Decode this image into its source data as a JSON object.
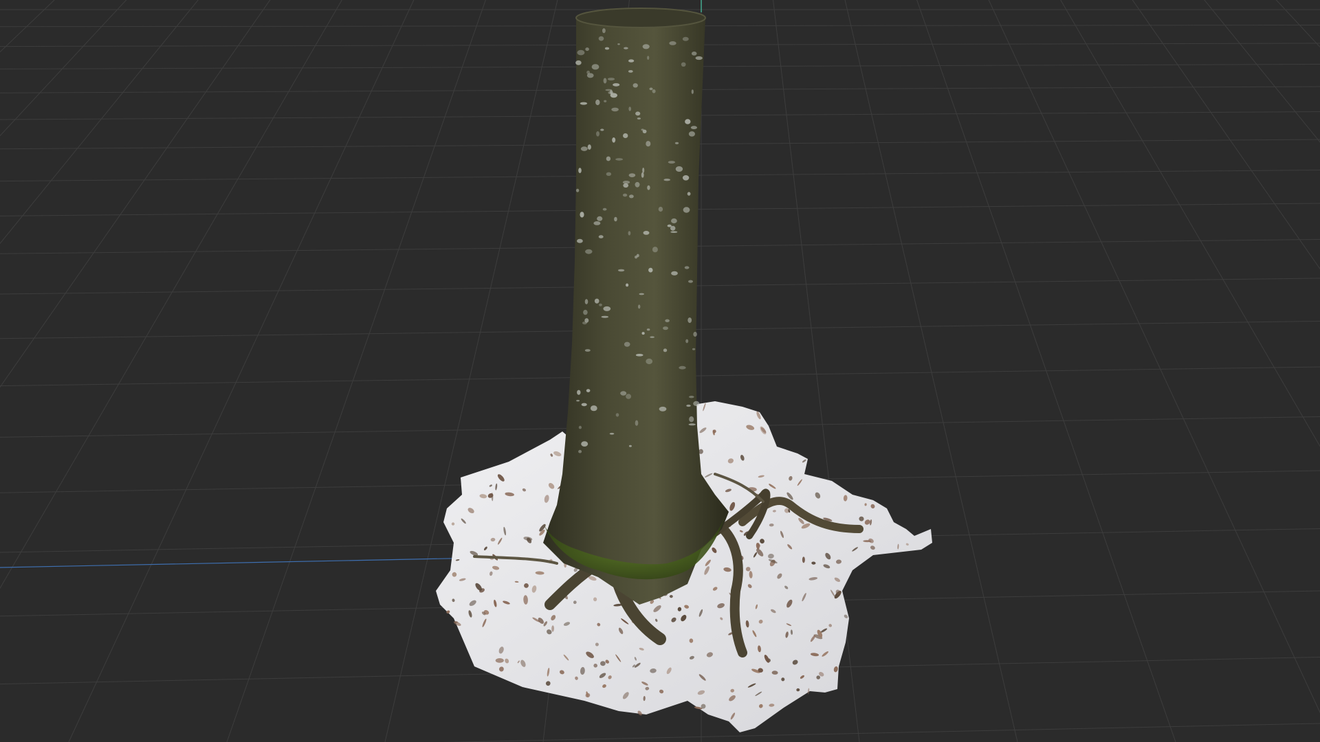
{
  "viewport": {
    "background_color": "#2b2b2b",
    "grid_line_color": "#3d3d3d",
    "x_axis_color": "#3e6fb0",
    "z_axis_color": "#4cc9a8"
  },
  "model": {
    "bark_color": "#3f3f2c",
    "bark_highlight": "#5a5a40",
    "moss_color": "#4a6a1f",
    "snow_color": "#e4e4e6",
    "leaf_color": "#8a6a58"
  }
}
